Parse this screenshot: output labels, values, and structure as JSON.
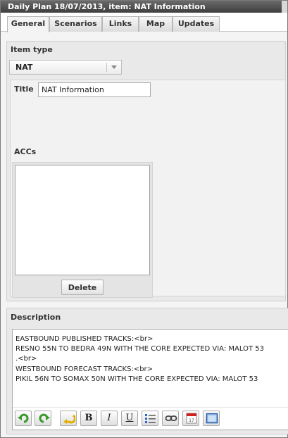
{
  "window": {
    "title": "Daily Plan 18/07/2013, item: NAT Information"
  },
  "tabs": [
    {
      "label": "General",
      "active": true
    },
    {
      "label": "Scenarios",
      "active": false
    },
    {
      "label": "Links",
      "active": false
    },
    {
      "label": "Map",
      "active": false
    },
    {
      "label": "Updates",
      "active": false
    }
  ],
  "item_type": {
    "label": "Item type",
    "selected": "NAT"
  },
  "title_field": {
    "label": "Title",
    "value": "NAT Information"
  },
  "accs": {
    "label": "ACCs",
    "items": [],
    "delete_label": "Delete"
  },
  "description": {
    "label": "Description",
    "lines": [
      "EASTBOUND PUBLISHED TRACKS:<br>",
      "RESNO 55N TO BEDRA 49N WITH THE CORE EXPECTED VIA: MALOT 53",
      ".<br>",
      "WESTBOUND FORECAST TRACKS:<br>",
      "PIKIL 56N TO SOMAX 50N WITH THE CORE EXPECTED VIA: MALOT 53"
    ]
  },
  "toolbar": {
    "undo_icon": "undo-icon",
    "redo_icon": "redo-icon",
    "clean_icon": "clean-format-icon",
    "bold_label": "B",
    "italic_label": "I",
    "underline_label": "U",
    "list_icon": "bullet-list-icon",
    "link_icon": "link-icon",
    "date_icon": "calendar-icon",
    "date_day": "17",
    "window_icon": "window-icon"
  },
  "colors": {
    "titlebar": "#4f4f4f",
    "undo_green": "#3a9a2a",
    "clean_yellow": "#e0b000",
    "calendar_red": "#d02020",
    "list_blue": "#2a6acb"
  }
}
